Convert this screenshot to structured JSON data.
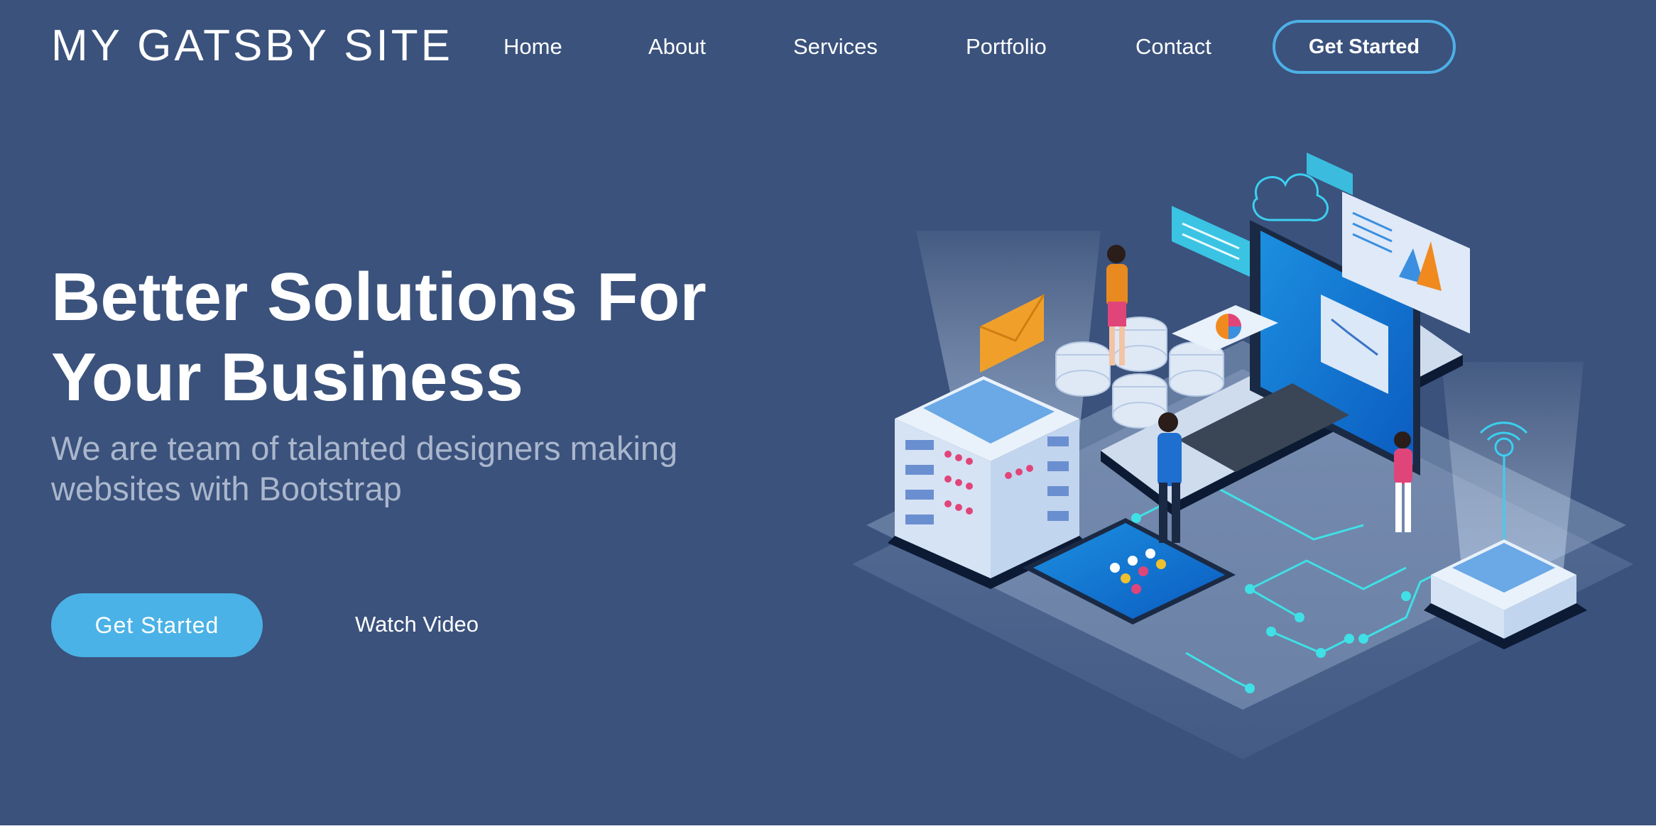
{
  "brand": {
    "name": "MY GATSBY SITE"
  },
  "nav": {
    "items": [
      {
        "label": "Home"
      },
      {
        "label": "About"
      },
      {
        "label": "Services"
      },
      {
        "label": "Portfolio"
      },
      {
        "label": "Contact"
      }
    ],
    "cta_label": "Get Started"
  },
  "hero": {
    "headline": "Better Solutions For Your Business",
    "subtitle": "We are team of talanted designers making websites with Bootstrap",
    "primary_button": "Get Started",
    "secondary_button": "Watch Video",
    "illustration_icon": "isometric-tech-illustration"
  },
  "colors": {
    "background": "#3a527c",
    "accent": "#4ab2e6",
    "subtitle_text": "#aab6cc",
    "text": "#ffffff"
  }
}
